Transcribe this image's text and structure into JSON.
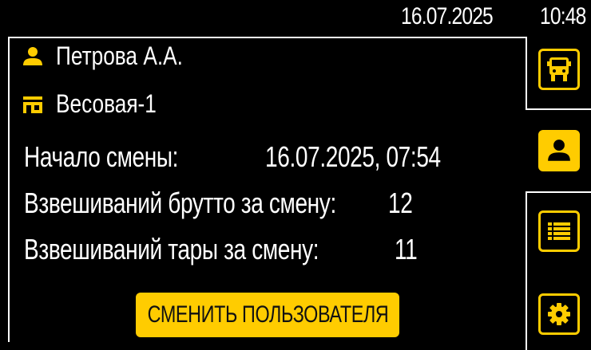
{
  "topbar": {
    "date": "16.07.2025",
    "time": "10:48"
  },
  "user": {
    "name": "Петрова А.А.",
    "icon": "person-icon"
  },
  "location": {
    "name": "Весовая-1",
    "icon": "store-icon"
  },
  "shift": {
    "start_label": "Начало смены:",
    "start_value": "16.07.2025, 07:54",
    "gross_label": "Взвешиваний брутто за смену:",
    "gross_value": "12",
    "tare_label": "Взвешиваний тары за смену:",
    "tare_value": "11"
  },
  "actions": {
    "change_user_label": "СМЕНИТЬ ПОЛЬЗОВАТЕЛЯ"
  },
  "nav": [
    {
      "id": "truck",
      "icon": "truck-icon",
      "active": false
    },
    {
      "id": "user",
      "icon": "person-icon",
      "active": true
    },
    {
      "id": "list",
      "icon": "list-icon",
      "active": false
    },
    {
      "id": "settings",
      "icon": "gear-icon",
      "active": false
    }
  ],
  "colors": {
    "accent": "#ffcc00",
    "background": "#000000",
    "text": "#ffffff"
  }
}
